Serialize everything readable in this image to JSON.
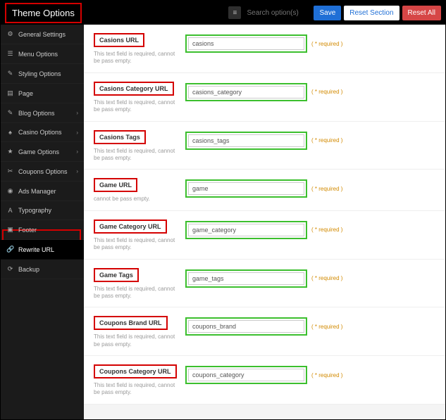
{
  "header": {
    "title": "Theme Options",
    "search_placeholder": "Search option(s)",
    "save_label": "Save",
    "reset_section_label": "Reset Section",
    "reset_all_label": "Reset All"
  },
  "sidebar": {
    "items": [
      {
        "label": "General Settings",
        "icon": "⚙",
        "expandable": false
      },
      {
        "label": "Menu Options",
        "icon": "☰",
        "expandable": false
      },
      {
        "label": "Styling Options",
        "icon": "✎",
        "expandable": false
      },
      {
        "label": "Page",
        "icon": "▤",
        "expandable": false
      },
      {
        "label": "Blog Options",
        "icon": "✎",
        "expandable": true
      },
      {
        "label": "Casino Options",
        "icon": "♠",
        "expandable": true
      },
      {
        "label": "Game Options",
        "icon": "★",
        "expandable": true
      },
      {
        "label": "Coupons Options",
        "icon": "✂",
        "expandable": true
      },
      {
        "label": "Ads Manager",
        "icon": "◉",
        "expandable": false
      },
      {
        "label": "Typography",
        "icon": "A",
        "expandable": false
      },
      {
        "label": "Footer",
        "icon": "▣",
        "expandable": false
      },
      {
        "label": "Rewrite URL",
        "icon": "🔗",
        "expandable": false,
        "active": true
      },
      {
        "label": "Backup",
        "icon": "⟳",
        "expandable": false
      }
    ]
  },
  "fields": [
    {
      "label": "Casions URL",
      "value": "casions",
      "desc": "This text field is required, cannot be pass empty.",
      "required": "( * required )"
    },
    {
      "label": "Casions Category URL",
      "value": "casions_category",
      "desc": "This text field is required, cannot be pass empty.",
      "required": "( * required )"
    },
    {
      "label": "Casions Tags",
      "value": "casions_tags",
      "desc": "This text field is required, cannot be pass empty.",
      "required": "( * required )"
    },
    {
      "label": "Game URL",
      "value": "game",
      "desc": "cannot be pass empty.",
      "required": "( * required )"
    },
    {
      "label": "Game Category URL",
      "value": "game_category",
      "desc": "This text field is required, cannot be pass empty.",
      "required": "( * required )"
    },
    {
      "label": "Game Tags",
      "value": "game_tags",
      "desc": "This text field is required, cannot be pass empty.",
      "required": "( * required )"
    },
    {
      "label": "Coupons Brand URL",
      "value": "coupons_brand",
      "desc": "This text field is required, cannot be pass empty.",
      "required": "( * required )"
    },
    {
      "label": "Coupons Category URL",
      "value": "coupons_category",
      "desc": "This text field is required, cannot be pass empty.",
      "required": "( * required )"
    }
  ]
}
